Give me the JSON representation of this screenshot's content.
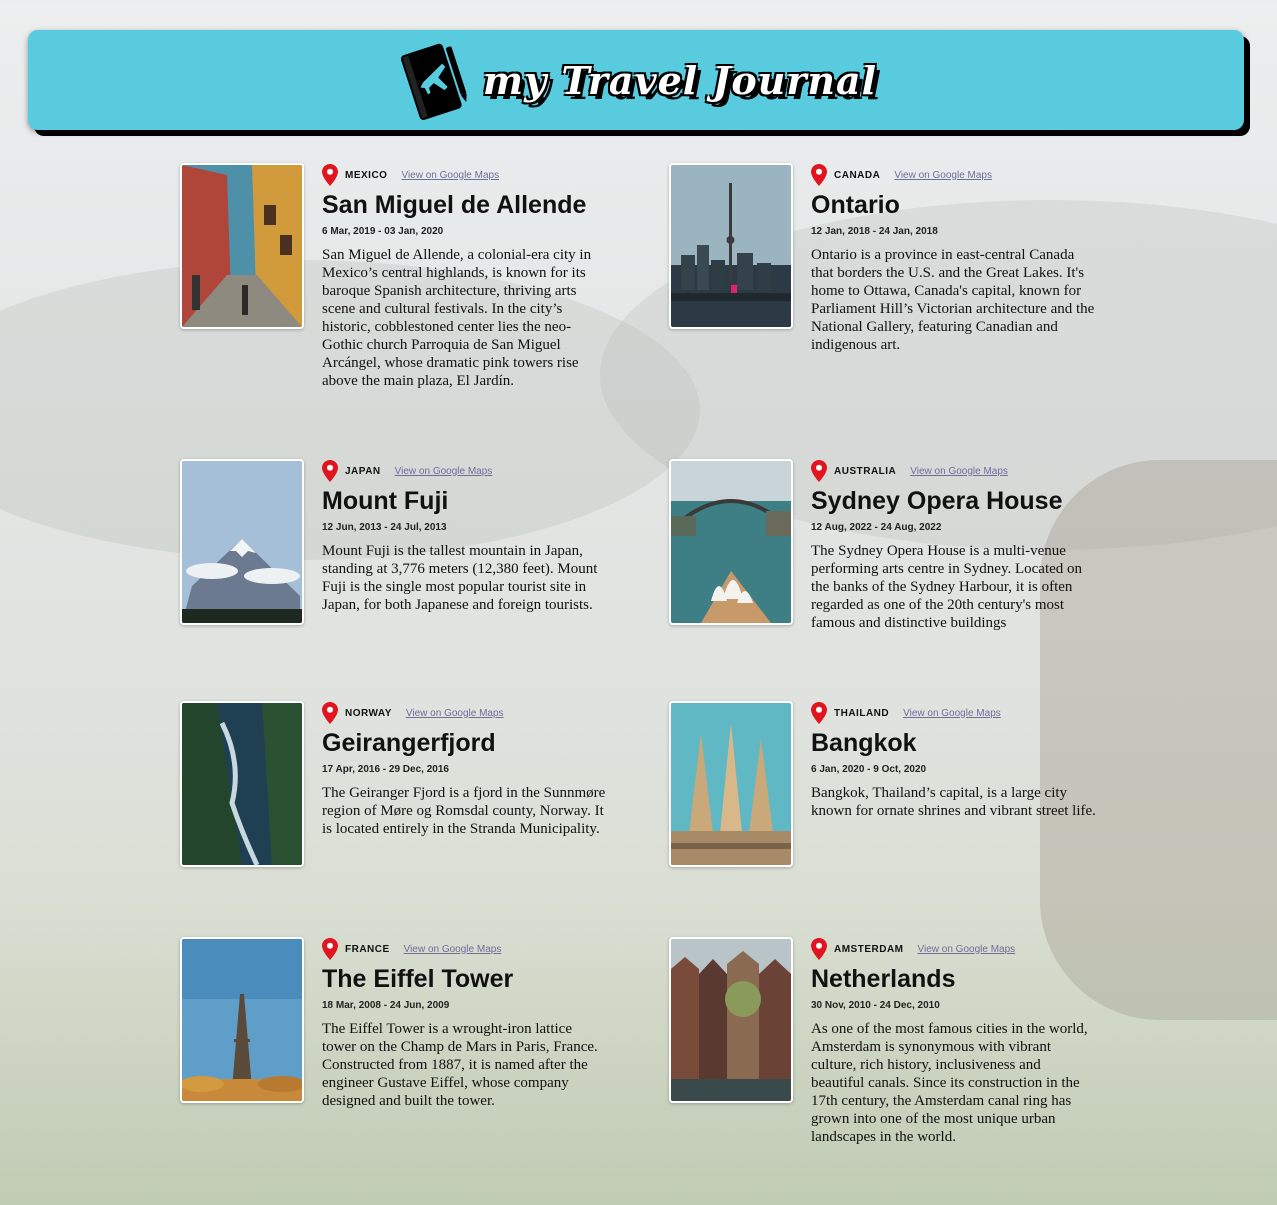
{
  "header": {
    "title": "my Travel Journal",
    "icon": "travel-journal-icon"
  },
  "link_label": "View on Google Maps",
  "entries": [
    {
      "country": "MEXICO",
      "title": "San Miguel de Allende",
      "dates": "6 Mar, 2019 - 03 Jan, 2020",
      "description": "San Miguel de Allende, a colonial-era city in Mexico’s central highlands, is known for its baroque Spanish architecture, thriving arts scene and cultural festivals. In the city’s historic, cobblestoned center lies the neo-Gothic church Parroquia de San Miguel Arcángel, whose dramatic pink towers rise above the main plaza, El Jardín."
    },
    {
      "country": "CANADA",
      "title": "Ontario",
      "dates": "12 Jan, 2018 - 24 Jan, 2018",
      "description": "Ontario is a province in east-central Canada that borders the U.S. and the Great Lakes. It's home to Ottawa, Canada's capital, known for Parliament Hill’s Victorian architecture and the National Gallery, featuring Canadian and indigenous art."
    },
    {
      "country": "JAPAN",
      "title": "Mount Fuji",
      "dates": "12 Jun, 2013 - 24 Jul, 2013",
      "description": "Mount Fuji is the tallest mountain in Japan, standing at 3,776 meters (12,380 feet). Mount Fuji is the single most popular tourist site in Japan, for both Japanese and foreign tourists."
    },
    {
      "country": "AUSTRALIA",
      "title": "Sydney Opera House",
      "dates": "12 Aug, 2022 - 24 Aug, 2022",
      "description": "The Sydney Opera House is a multi-venue performing arts centre in Sydney. Located on the banks of the Sydney Harbour, it is often regarded as one of the 20th century's most famous and distinctive buildings"
    },
    {
      "country": "NORWAY",
      "title": "Geirangerfjord",
      "dates": "17 Apr, 2016 - 29 Dec, 2016",
      "description": "The Geiranger Fjord is a fjord in the Sunnmøre region of Møre og Romsdal county, Norway. It is located entirely in the Stranda Municipality."
    },
    {
      "country": "THAILAND",
      "title": "Bangkok",
      "dates": "6 Jan, 2020 - 9 Oct, 2020",
      "description": "Bangkok, Thailand’s capital, is a large city known for ornate shrines and vibrant street life."
    },
    {
      "country": "FRANCE",
      "title": "The Eiffel Tower",
      "dates": "18 Mar, 2008 - 24 Jun, 2009",
      "description": "The Eiffel Tower is a wrought-iron lattice tower on the Champ de Mars in Paris, France. Constructed from 1887, it is named after the engineer Gustave Eiffel, whose company designed and built the tower."
    },
    {
      "country": "AMSTERDAM",
      "title": "Netherlands",
      "dates": "30 Nov, 2010 - 24 Dec, 2010",
      "description": "As one of the most famous cities in the world, Amsterdam is synonymous with vibrant culture, rich history, inclusiveness and beautiful canals. Since its construction in the 17th century, the Amsterdam canal ring has grown into one of the most unique urban landscapes in the world."
    }
  ],
  "colors": {
    "header_bg": "#58cbde",
    "pin_red": "#e0151f",
    "link": "#6e6e9a"
  }
}
